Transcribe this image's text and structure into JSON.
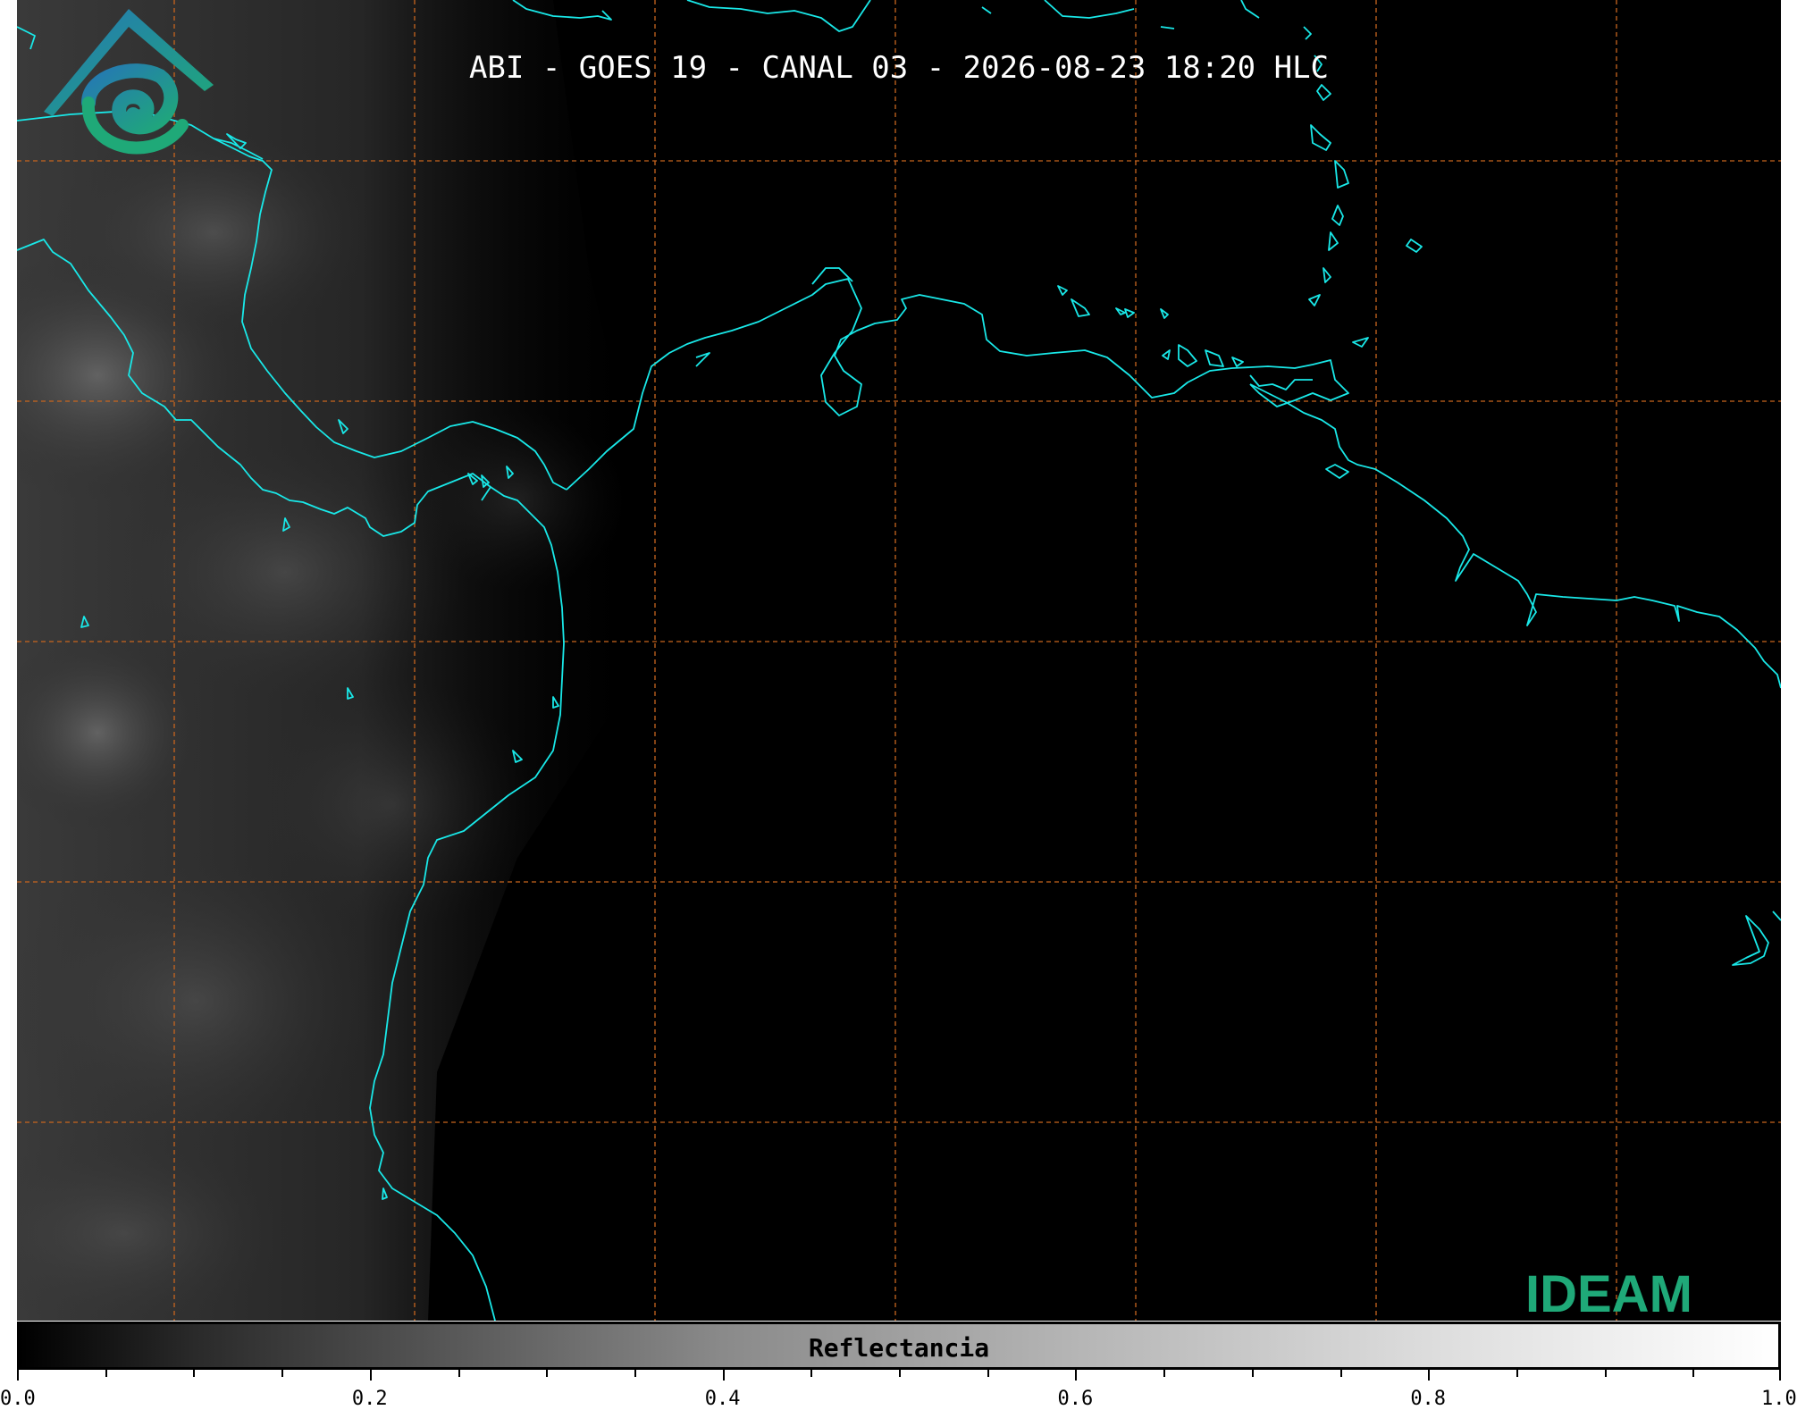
{
  "title": "ABI - GOES 19 - CANAL 03 - 2026-08-23 18:20 HLC",
  "colorbar": {
    "label": "Reflectancia",
    "range": [
      0.0,
      1.0
    ],
    "ticks": [
      "0.0",
      "0.2",
      "0.4",
      "0.6",
      "0.8",
      "1.0"
    ],
    "colormap": "grayscale"
  },
  "logo": {
    "text": "IDEAM"
  },
  "colors": {
    "coastline": "#19e8e8",
    "grid": "#c8651e",
    "background": "#000000"
  }
}
